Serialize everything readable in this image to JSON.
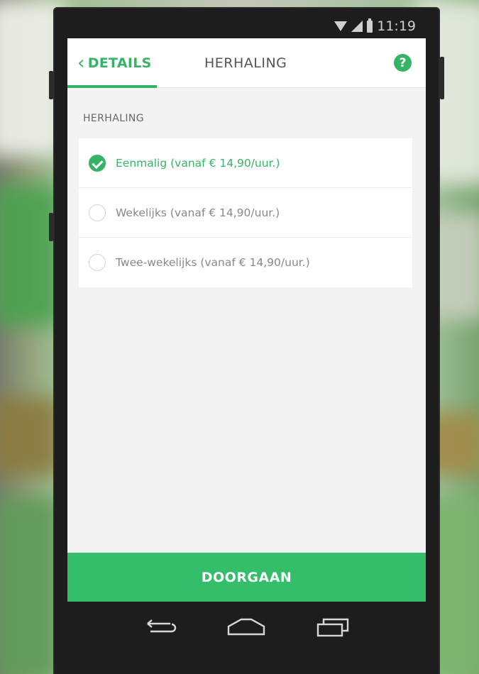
{
  "status_bar": {
    "time": "11:19",
    "icons": [
      "wifi-icon",
      "signal-icon",
      "battery-icon"
    ]
  },
  "header": {
    "back_label": "DETAILS",
    "back_icon": "chevron-left-icon",
    "title": "HERHALING",
    "help_icon": "question-icon",
    "help_glyph": "?"
  },
  "section": {
    "label": "HERHALING"
  },
  "options": [
    {
      "label": "Eenmalig (vanaf € 14,90/uur.)",
      "selected": true
    },
    {
      "label": "Wekelijks (vanaf € 14,90/uur.)",
      "selected": false
    },
    {
      "label": "Twee-wekelijks (vanaf € 14,90/uur.)",
      "selected": false
    }
  ],
  "cta": {
    "label": "DOORGAAN"
  },
  "nav": [
    "back-icon",
    "home-icon",
    "recent-apps-icon"
  ],
  "colors": {
    "accent": "#35b465",
    "cta": "#35be6a",
    "screen_bg": "#f3f3f3"
  }
}
